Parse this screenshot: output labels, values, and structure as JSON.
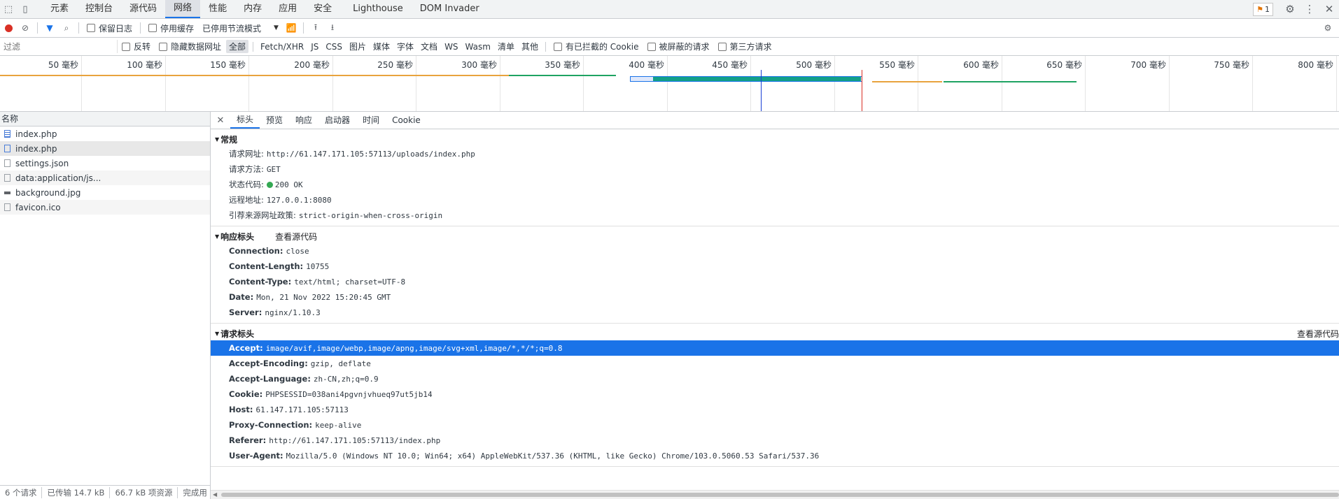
{
  "top_tabs": [
    "元素",
    "控制台",
    "源代码",
    "网络",
    "性能",
    "内存",
    "应用",
    "安全",
    "Lighthouse",
    "DOM Invader"
  ],
  "active_tab": "网络",
  "issues_badge": "1",
  "toolbar": {
    "preserve_log": "保留日志",
    "disable_cache": "停用缓存",
    "throttling": "已停用节流模式"
  },
  "filter": {
    "placeholder": "过滤",
    "invert": "反转",
    "hide_data_urls": "隐藏数据网址",
    "types": [
      "全部",
      "Fetch/XHR",
      "JS",
      "CSS",
      "图片",
      "媒体",
      "字体",
      "文档",
      "WS",
      "Wasm",
      "清单",
      "其他"
    ],
    "selected_type": "全部",
    "blocked_cookies": "有已拦截的 Cookie",
    "blocked_requests": "被屏蔽的请求",
    "third_party": "第三方请求"
  },
  "timeline_ticks": [
    "50 毫秒",
    "100 毫秒",
    "150 毫秒",
    "200 毫秒",
    "250 毫秒",
    "300 毫秒",
    "350 毫秒",
    "400 毫秒",
    "450 毫秒",
    "500 毫秒",
    "550 毫秒",
    "600 毫秒",
    "650 毫秒",
    "700 毫秒",
    "750 毫秒",
    "800 毫秒"
  ],
  "requests_header": "名称",
  "requests": [
    {
      "name": "index.php",
      "icon": "document-icon"
    },
    {
      "name": "index.php",
      "icon": "document-icon"
    },
    {
      "name": "settings.json",
      "icon": "file-icon"
    },
    {
      "name": "data:application/js...",
      "icon": "file-icon"
    },
    {
      "name": "background.jpg",
      "icon": "image-icon"
    },
    {
      "name": "favicon.ico",
      "icon": "file-icon"
    }
  ],
  "selected_request_index": 1,
  "status_bar": [
    "6 个请求",
    "已传输 14.7 kB",
    "66.7 kB 项资源",
    "完成用"
  ],
  "detail_tabs": [
    "标头",
    "预览",
    "响应",
    "启动器",
    "时间",
    "Cookie"
  ],
  "active_detail_tab": "标头",
  "general": {
    "title": "常规",
    "url_label": "请求网址:",
    "url": "http://61.147.171.105:57113/uploads/index.php",
    "method_label": "请求方法:",
    "method": "GET",
    "status_label": "状态代码:",
    "status": "200 OK",
    "remote_label": "远程地址:",
    "remote": "127.0.0.1:8080",
    "policy_label": "引荐来源网址政策:",
    "policy": "strict-origin-when-cross-origin"
  },
  "response_headers": {
    "title": "响应标头",
    "view_source": "查看源代码",
    "rows": [
      {
        "k": "Connection:",
        "v": "close"
      },
      {
        "k": "Content-Length:",
        "v": "10755"
      },
      {
        "k": "Content-Type:",
        "v": "text/html; charset=UTF-8"
      },
      {
        "k": "Date:",
        "v": "Mon, 21 Nov 2022 15:20:45 GMT"
      },
      {
        "k": "Server:",
        "v": "nginx/1.10.3"
      }
    ]
  },
  "request_headers": {
    "title": "请求标头",
    "view_source": "查看源代码",
    "rows": [
      {
        "k": "Accept:",
        "v": "image/avif,image/webp,image/apng,image/svg+xml,image/*,*/*;q=0.8"
      },
      {
        "k": "Accept-Encoding:",
        "v": "gzip, deflate"
      },
      {
        "k": "Accept-Language:",
        "v": "zh-CN,zh;q=0.9"
      },
      {
        "k": "Cookie:",
        "v": "PHPSESSID=038ani4pgvnjvhueq97ut5jb14"
      },
      {
        "k": "Host:",
        "v": "61.147.171.105:57113"
      },
      {
        "k": "Proxy-Connection:",
        "v": "keep-alive"
      },
      {
        "k": "Referer:",
        "v": "http://61.147.171.105:57113/index.php"
      },
      {
        "k": "User-Agent:",
        "v": "Mozilla/5.0 (Windows NT 10.0; Win64; x64) AppleWebKit/537.36 (KHTML, like Gecko) Chrome/103.0.5060.53 Safari/537.36"
      }
    ]
  }
}
